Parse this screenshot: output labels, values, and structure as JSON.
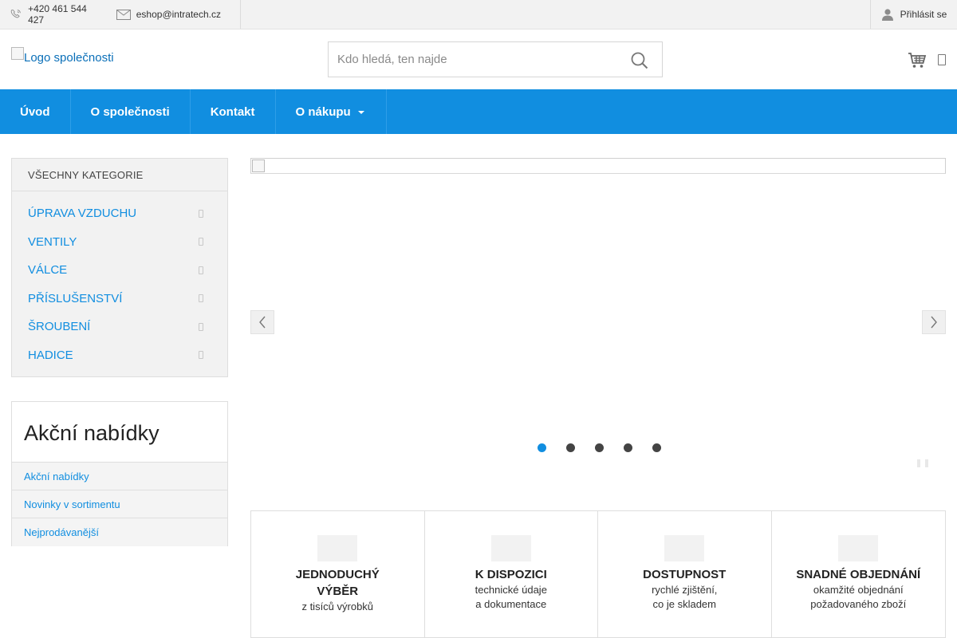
{
  "topbar": {
    "phone": "+420 461 544 427",
    "email": "eshop@intratech.cz",
    "login": "Přihlásit se"
  },
  "header": {
    "logo_alt": "Logo společnosti",
    "search_placeholder": "Kdo hledá, ten najde"
  },
  "nav": {
    "items": [
      {
        "label": "Úvod"
      },
      {
        "label": "O společnosti"
      },
      {
        "label": "Kontakt"
      },
      {
        "label": "O nákupu"
      }
    ]
  },
  "categories": {
    "heading": "VŠECHNY KATEGORIE",
    "items": [
      {
        "label": "ÚPRAVA VZDUCHU"
      },
      {
        "label": "VENTILY"
      },
      {
        "label": "VÁLCE"
      },
      {
        "label": "PŘÍSLUŠENSTVÍ"
      },
      {
        "label": "ŠROUBENÍ"
      },
      {
        "label": "HADICE"
      }
    ]
  },
  "promo": {
    "title": "Akční nabídky",
    "links": [
      {
        "label": "Akční nabídky"
      },
      {
        "label": "Novinky v sortimentu"
      },
      {
        "label": "Nejprodávanější"
      }
    ]
  },
  "slider": {
    "slide_count": 5,
    "active_index": 0
  },
  "features": [
    {
      "title": "JEDNODUCHÝ VÝBĚR",
      "line1": "z tisíců výrobků",
      "line2": ""
    },
    {
      "title": "K DISPOZICI",
      "line1": "technické údaje",
      "line2": "a dokumentace"
    },
    {
      "title": "DOSTUPNOST",
      "line1": "rychlé zjištění,",
      "line2": "co je skladem"
    },
    {
      "title": "SNADNÉ OBJEDNÁNÍ",
      "line1": "okamžité objednání",
      "line2": "požadovaného zboží"
    }
  ],
  "colors": {
    "accent": "#118ee0",
    "topbar_bg": "#f2f2f2"
  }
}
